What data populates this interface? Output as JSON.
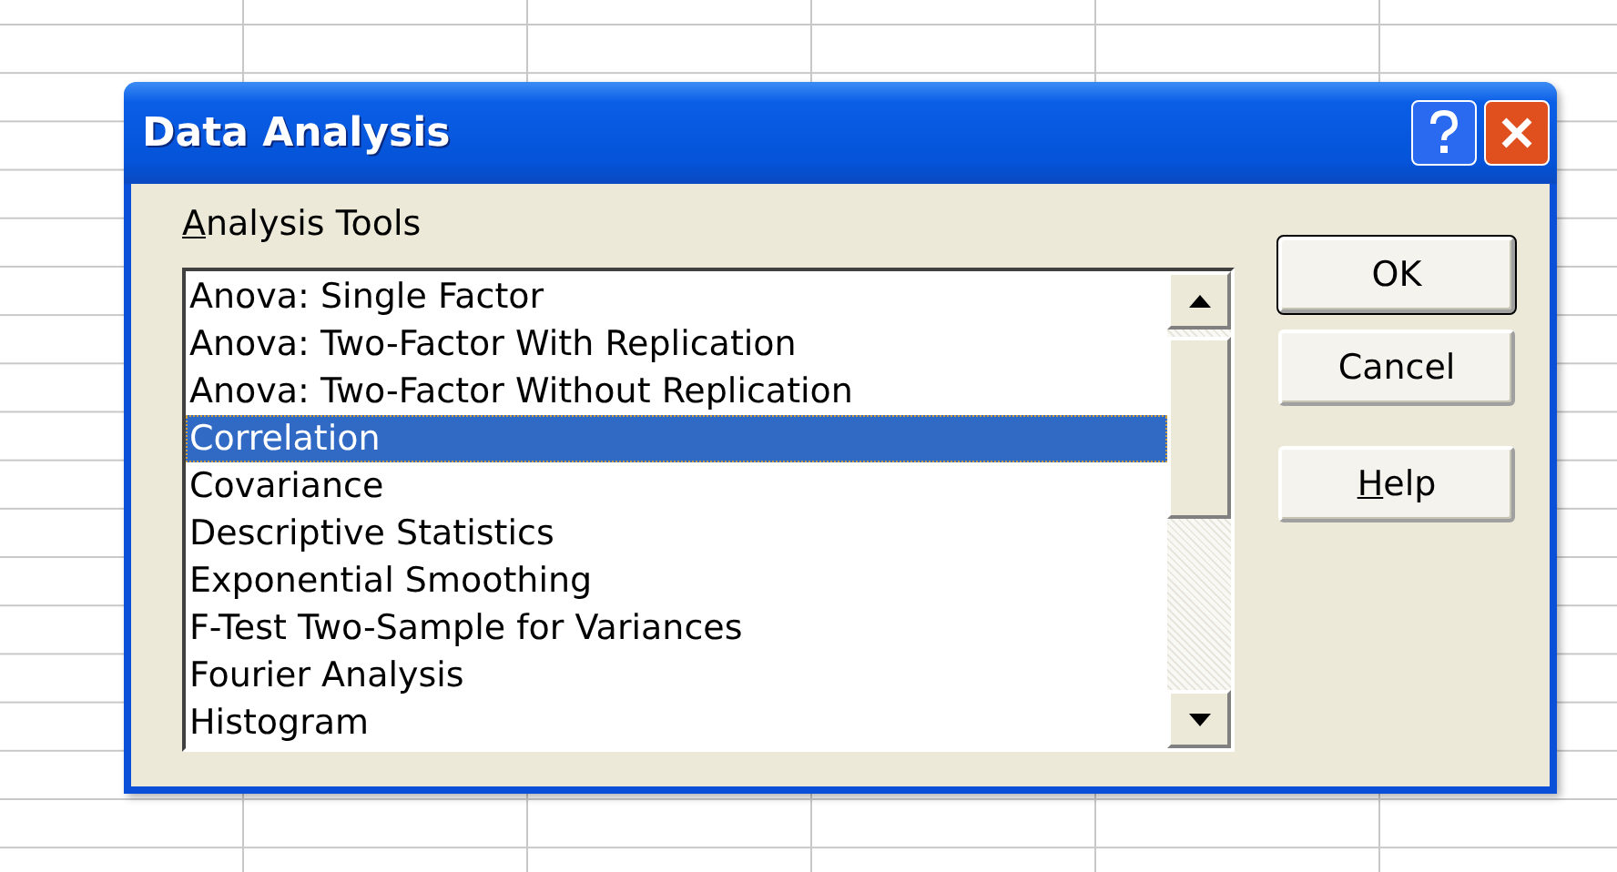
{
  "window": {
    "title": "Data Analysis"
  },
  "list_label": {
    "mnemonic": "A",
    "rest": "nalysis Tools"
  },
  "tools": [
    {
      "label": "Anova: Single Factor",
      "selected": false
    },
    {
      "label": "Anova: Two-Factor With Replication",
      "selected": false
    },
    {
      "label": "Anova: Two-Factor Without Replication",
      "selected": false
    },
    {
      "label": "Correlation",
      "selected": true
    },
    {
      "label": "Covariance",
      "selected": false
    },
    {
      "label": "Descriptive Statistics",
      "selected": false
    },
    {
      "label": "Exponential Smoothing",
      "selected": false
    },
    {
      "label": "F-Test Two-Sample for Variances",
      "selected": false
    },
    {
      "label": "Fourier Analysis",
      "selected": false
    },
    {
      "label": "Histogram",
      "selected": false
    }
  ],
  "buttons": [
    {
      "rest": "OK",
      "default": true
    },
    {
      "rest": "Cancel",
      "default": false
    },
    {
      "mnemonic": "H",
      "rest": "elp",
      "default": false
    }
  ]
}
